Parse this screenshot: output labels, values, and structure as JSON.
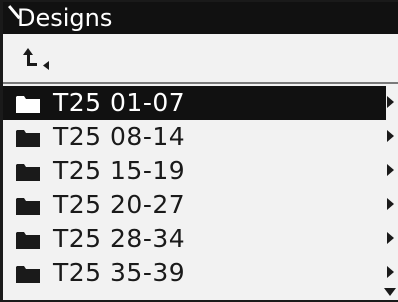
{
  "window": {
    "title": "Designs"
  },
  "toolbar": {
    "up_icon": "up-folder-arrow-icon"
  },
  "folders": [
    {
      "label": "T25 01-07",
      "selected": true
    },
    {
      "label": "T25 08-14",
      "selected": false
    },
    {
      "label": "T25 15-19",
      "selected": false
    },
    {
      "label": "T25 20-27",
      "selected": false
    },
    {
      "label": "T25 28-34",
      "selected": false
    },
    {
      "label": "T25 35-39",
      "selected": false
    }
  ],
  "colors": {
    "background": "#f2f2f2",
    "highlight": "#111111",
    "text": "#1a1a1a",
    "highlight_text": "#ffffff"
  }
}
